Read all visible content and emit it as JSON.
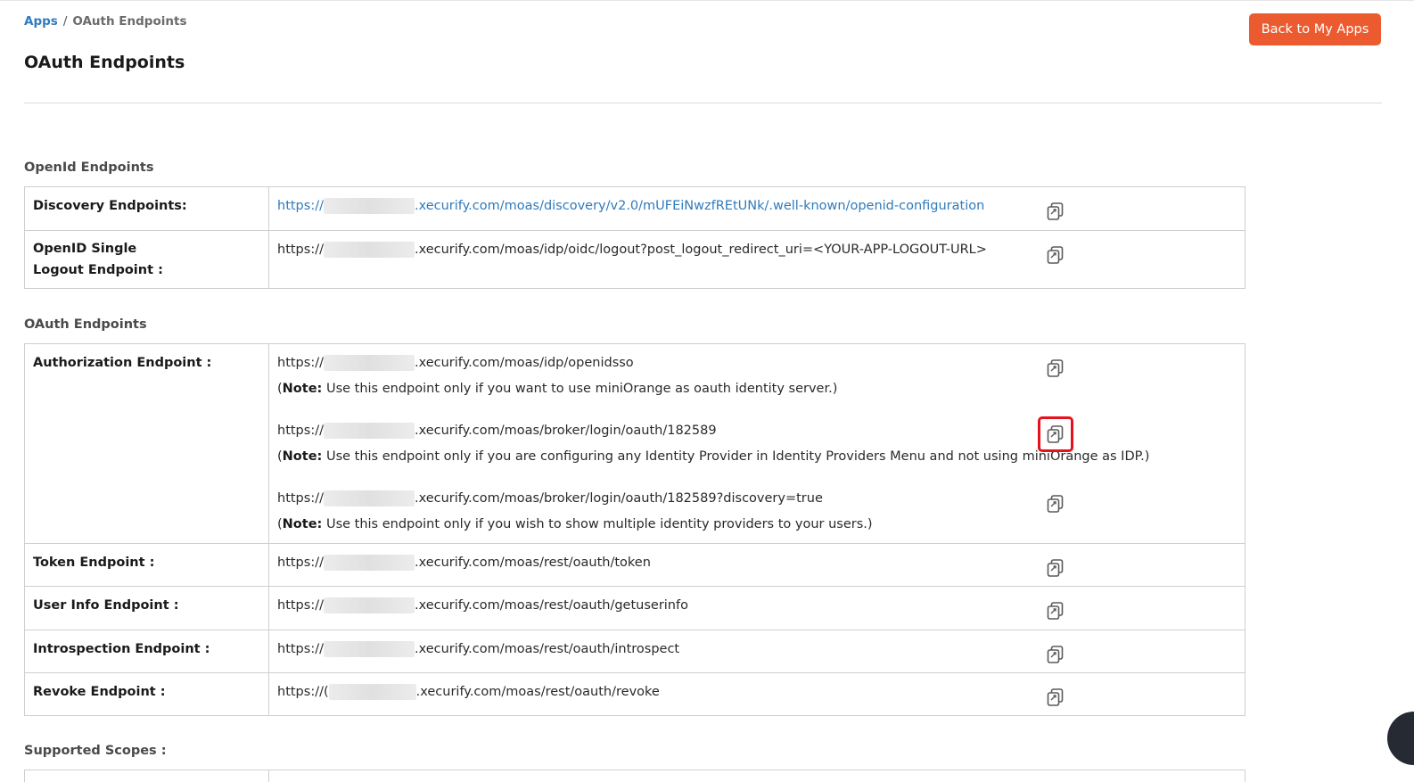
{
  "breadcrumb": {
    "root": "Apps",
    "separator": "/",
    "current": "OAuth Endpoints"
  },
  "page": {
    "title": "OAuth Endpoints"
  },
  "actions": {
    "back_label": "Back to My Apps"
  },
  "sections": {
    "openid_title": "OpenId Endpoints",
    "oauth_title": "OAuth Endpoints",
    "scopes_title": "Supported Scopes :"
  },
  "openid": [
    {
      "label": "Discovery Endpoints:",
      "scheme": "https://",
      "path": ".xecurify.com/moas/discovery/v2.0/mUFEiNwzfREtUNk/.well-known/openid-configuration"
    },
    {
      "label_line1": "OpenID Single",
      "label_line2": "Logout Endpoint :",
      "scheme": "https://",
      "path": ".xecurify.com/moas/idp/oidc/logout?post_logout_redirect_uri=<YOUR-APP-LOGOUT-URL>"
    }
  ],
  "oauth": {
    "authorization": {
      "label": "Authorization Endpoint :",
      "entries": [
        {
          "scheme": "https://",
          "path": ".xecurify.com/moas/idp/openidsso",
          "note_open": "(",
          "note_bold": "Note:",
          "note_text": " Use this endpoint only if you want to use miniOrange as oauth identity server.)"
        },
        {
          "scheme": "https://",
          "path": ".xecurify.com/moas/broker/login/oauth/182589",
          "note_open": "(",
          "note_bold": "Note:",
          "note_text": " Use this endpoint only if you are configuring any Identity Provider in Identity Providers Menu and not using miniOrange as IDP.)"
        },
        {
          "scheme": "https://",
          "path": ".xecurify.com/moas/broker/login/oauth/182589?discovery=true",
          "note_open": "(",
          "note_bold": "Note:",
          "note_text": " Use this endpoint only if you wish to show multiple identity providers to your users.)"
        }
      ]
    },
    "others": [
      {
        "label": "Token Endpoint :",
        "scheme": "https://",
        "path": ".xecurify.com/moas/rest/oauth/token"
      },
      {
        "label": "User Info Endpoint :",
        "scheme": "https://",
        "path": ".xecurify.com/moas/rest/oauth/getuserinfo"
      },
      {
        "label": "Introspection Endpoint :",
        "scheme": "https://",
        "path": ".xecurify.com/moas/rest/oauth/introspect"
      },
      {
        "label": "Revoke Endpoint :",
        "scheme": "https://(",
        "path": ".xecurify.com/moas/rest/oauth/revoke"
      }
    ]
  },
  "icons": {
    "copy": "copy-icon"
  },
  "colors": {
    "accent": "#ec5b30",
    "link": "#2f7bbd",
    "highlight": "#e8101b"
  }
}
